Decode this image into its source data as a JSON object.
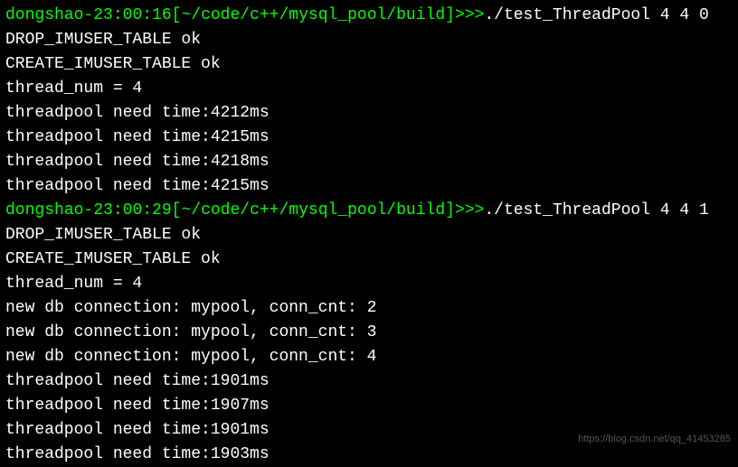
{
  "lines": [
    {
      "type": "prompt",
      "user": "dongshao",
      "sep": "-",
      "time": "23:00:16",
      "lbracket": "[",
      "path": "~/code/c++/mysql_pool/build",
      "rbracket": "]",
      "arrows": ">>>",
      "command": "./test_ThreadPool 4 4 0"
    },
    {
      "type": "output",
      "text": "DROP_IMUSER_TABLE ok"
    },
    {
      "type": "output",
      "text": "CREATE_IMUSER_TABLE ok"
    },
    {
      "type": "output",
      "text": "thread_num = 4"
    },
    {
      "type": "output",
      "text": "threadpool need time:4212ms"
    },
    {
      "type": "output",
      "text": "threadpool need time:4215ms"
    },
    {
      "type": "output",
      "text": "threadpool need time:4218ms"
    },
    {
      "type": "output",
      "text": "threadpool need time:4215ms"
    },
    {
      "type": "prompt",
      "user": "dongshao",
      "sep": "-",
      "time": "23:00:29",
      "lbracket": "[",
      "path": "~/code/c++/mysql_pool/build",
      "rbracket": "]",
      "arrows": ">>>",
      "command": "./test_ThreadPool 4 4 1"
    },
    {
      "type": "output",
      "text": "DROP_IMUSER_TABLE ok"
    },
    {
      "type": "output",
      "text": "CREATE_IMUSER_TABLE ok"
    },
    {
      "type": "output",
      "text": "thread_num = 4"
    },
    {
      "type": "output",
      "text": "new db connection: mypool, conn_cnt: 2"
    },
    {
      "type": "output",
      "text": "new db connection: mypool, conn_cnt: 3"
    },
    {
      "type": "output",
      "text": "new db connection: mypool, conn_cnt: 4"
    },
    {
      "type": "output",
      "text": "threadpool need time:1901ms"
    },
    {
      "type": "output",
      "text": "threadpool need time:1907ms"
    },
    {
      "type": "output",
      "text": "threadpool need time:1901ms"
    },
    {
      "type": "output",
      "text": "threadpool need time:1903ms"
    }
  ],
  "watermark": "https://blog.csdn.net/qq_41453285"
}
